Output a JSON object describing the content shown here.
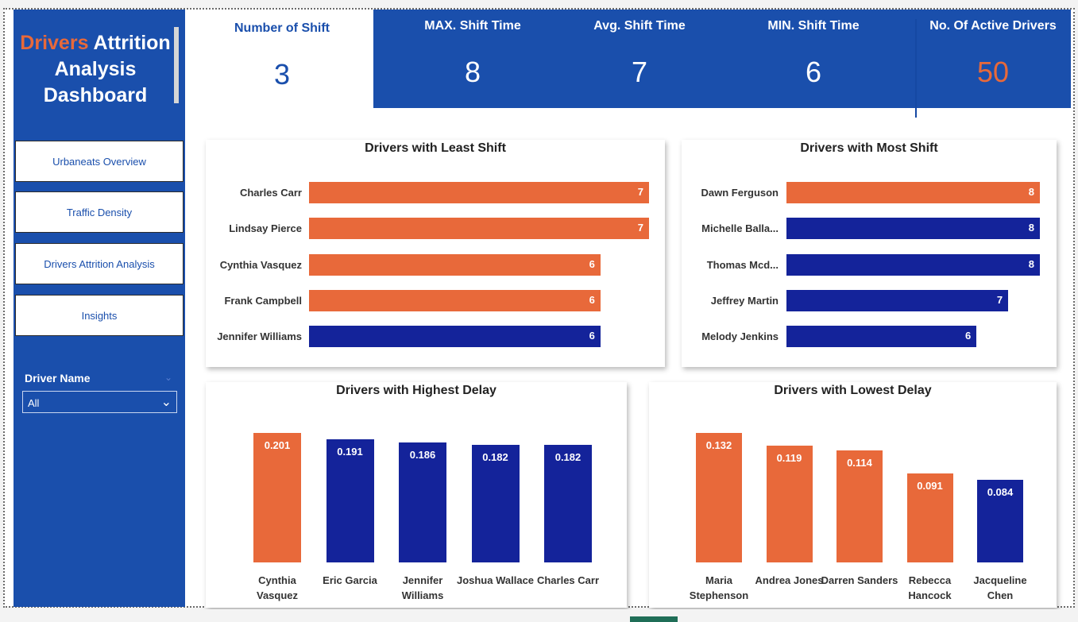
{
  "dashboard": {
    "title_accent": "Drivers",
    "title_rest": "Attrition Analysis Dashboard"
  },
  "nav": {
    "items": [
      {
        "label": "Urbaneats Overview"
      },
      {
        "label": "Traffic Density"
      },
      {
        "label": "Drivers Attrition Analysis"
      },
      {
        "label": "Insights"
      }
    ]
  },
  "slicer": {
    "label": "Driver Name",
    "selected": "All"
  },
  "kpis": [
    {
      "label": "Number of Shift",
      "value": "3"
    },
    {
      "label": "MAX. Shift Time",
      "value": "8"
    },
    {
      "label": "Avg. Shift Time",
      "value": "7"
    },
    {
      "label": "MIN. Shift Time",
      "value": "6"
    },
    {
      "label": "No. Of Active Drivers",
      "value": "50"
    }
  ],
  "colors": {
    "sidebar": "#1a4fac",
    "orange": "#e8693a",
    "navy": "#14239a"
  },
  "chart_data": [
    {
      "type": "bar",
      "orientation": "horizontal",
      "title": "Drivers with Least Shift",
      "categories": [
        "Charles Carr",
        "Lindsay Pierce",
        "Cynthia Vasquez",
        "Frank Campbell",
        "Jennifer Williams"
      ],
      "values": [
        7,
        7,
        6,
        6,
        6
      ],
      "colors": [
        "orange",
        "orange",
        "orange",
        "orange",
        "navy"
      ],
      "xlim": [
        0,
        7
      ]
    },
    {
      "type": "bar",
      "orientation": "horizontal",
      "title": "Drivers with Most Shift",
      "categories": [
        "Dawn Ferguson",
        "Michelle Balla...",
        "Thomas Mcd...",
        "Jeffrey Martin",
        "Melody Jenkins"
      ],
      "values": [
        8,
        8,
        8,
        7,
        6
      ],
      "colors": [
        "orange",
        "navy",
        "navy",
        "navy",
        "navy"
      ],
      "xlim": [
        0,
        8
      ]
    },
    {
      "type": "bar",
      "orientation": "vertical",
      "title": "Drivers with Highest Delay",
      "categories": [
        "Cynthia Vasquez",
        "Eric Garcia",
        "Jennifer Williams",
        "Joshua Wallace",
        "Charles Carr"
      ],
      "value_labels": [
        "0.201",
        "0.191",
        "0.186",
        "0.182",
        "0.182"
      ],
      "values": [
        0.201,
        0.191,
        0.186,
        0.182,
        0.182
      ],
      "colors": [
        "orange",
        "navy",
        "navy",
        "navy",
        "navy"
      ],
      "ylim": [
        0,
        0.201
      ]
    },
    {
      "type": "bar",
      "orientation": "vertical",
      "title": "Drivers with Lowest Delay",
      "categories": [
        "Maria Stephenson",
        "Andrea Jones",
        "Darren Sanders",
        "Rebecca Hancock",
        "Jacqueline Chen"
      ],
      "value_labels": [
        "0.132",
        "0.119",
        "0.114",
        "0.091",
        "0.084"
      ],
      "values": [
        0.132,
        0.119,
        0.114,
        0.091,
        0.084
      ],
      "colors": [
        "orange",
        "orange",
        "orange",
        "orange",
        "navy"
      ],
      "ylim": [
        0,
        0.132
      ]
    }
  ]
}
